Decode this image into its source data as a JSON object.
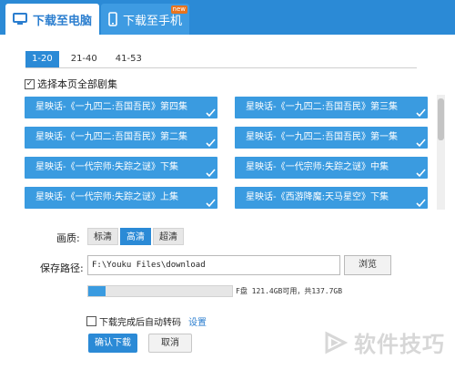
{
  "tabs": {
    "pc": {
      "label": "下载至电脑",
      "icon": "monitor-icon"
    },
    "phone": {
      "label": "下载至手机",
      "icon": "phone-icon",
      "badge": "new"
    }
  },
  "ranges": [
    {
      "label": "1-20",
      "active": true
    },
    {
      "label": "21-40",
      "active": false
    },
    {
      "label": "41-53",
      "active": false
    }
  ],
  "select_all": {
    "label": "选择本页全部剧集",
    "checked": true
  },
  "episodes": [
    "星映话-《一九四二:吾国吾民》第四集",
    "星映话-《一九四二:吾国吾民》第三集",
    "星映话-《一九四二:吾国吾民》第二集",
    "星映话-《一九四二:吾国吾民》第一集",
    "星映话-《一代宗师:失踪之谜》下集",
    "星映话-《一代宗师:失踪之谜》中集",
    "星映话-《一代宗师:失踪之谜》上集",
    "星映话-《西游降魔:天马星空》下集"
  ],
  "quality": {
    "label": "画质:",
    "options": [
      "标清",
      "高清",
      "超清"
    ],
    "selected": "高清"
  },
  "save_path": {
    "label": "保存路径:",
    "value": "F:\\Youku Files\\download",
    "browse_label": "浏览"
  },
  "disk": {
    "text": "F盘 121.4GB可用，共137.7GB",
    "used_fraction": 0.1184
  },
  "auto_transcode": {
    "label": "下载完成后自动转码",
    "checked": false,
    "settings_label": "设置"
  },
  "buttons": {
    "confirm": "确认下载",
    "cancel": "取消"
  },
  "watermark": {
    "text": "软件技巧"
  },
  "colors": {
    "accent": "#2b8ad6",
    "episode_bg": "#3a9be0"
  }
}
